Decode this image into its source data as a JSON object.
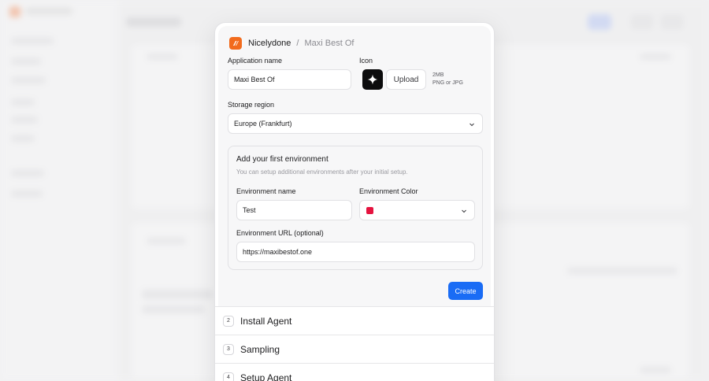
{
  "breadcrumb": {
    "org": "Nicelydone",
    "separator": "/",
    "app": "Maxi Best Of"
  },
  "form": {
    "app_name_label": "Application name",
    "app_name_value": "Maxi Best Of",
    "icon_label": "Icon",
    "icon_name": "sparkle-icon",
    "upload_label": "Upload",
    "upload_hint_size": "2MB",
    "upload_hint_types": "PNG or JPG",
    "region_label": "Storage region",
    "region_value": "Europe (Frankfurt)"
  },
  "environment": {
    "title": "Add your first environment",
    "subtitle": "You can setup additional environments after your initial setup.",
    "name_label": "Environment name",
    "name_value": "Test",
    "color_label": "Environment Color",
    "color_value": "#e5133f",
    "url_label": "Environment URL (optional)",
    "url_value": "https://maxibestof.one"
  },
  "create_label": "Create",
  "steps": [
    {
      "num": "2",
      "label": "Install Agent"
    },
    {
      "num": "3",
      "label": "Sampling"
    },
    {
      "num": "4",
      "label": "Setup Agent"
    }
  ],
  "colors": {
    "accent": "#1a6cf5",
    "brand": "#f26b1d",
    "env": "#e5133f"
  }
}
